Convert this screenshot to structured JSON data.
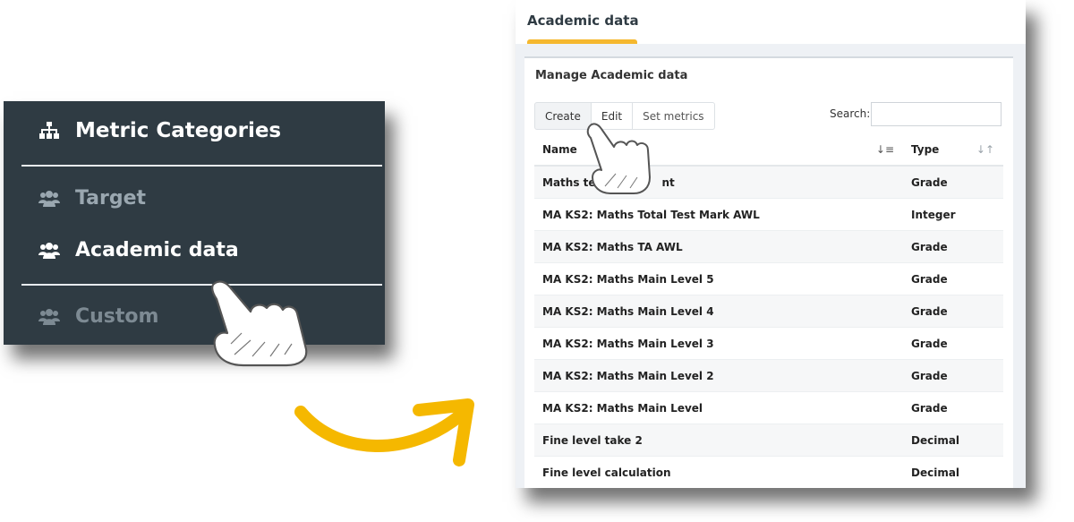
{
  "sidebar": {
    "title": "Metric Categories",
    "items": [
      {
        "label": "Target"
      },
      {
        "label": "Academic data"
      },
      {
        "label": "Custom"
      }
    ]
  },
  "panel": {
    "tab_title": "Academic data",
    "box_title": "Manage Academic data",
    "buttons": {
      "create": "Create",
      "edit": "Edit",
      "set_metrics": "Set metrics"
    },
    "search_label": "Search:",
    "search_value": "",
    "table": {
      "headers": {
        "name": "Name",
        "type": "Type"
      },
      "rows": [
        {
          "name": "Maths te",
          "name_tail": "nt",
          "type": "Grade"
        },
        {
          "name": "MA KS2: Maths Total Test Mark AWL",
          "type": "Integer"
        },
        {
          "name": "MA KS2: Maths TA AWL",
          "type": "Grade"
        },
        {
          "name": "MA KS2: Maths Main Level 5",
          "type": "Grade"
        },
        {
          "name": "MA KS2: Maths Main Level 4",
          "type": "Grade"
        },
        {
          "name": "MA KS2: Maths Main Level 3",
          "type": "Grade"
        },
        {
          "name": "MA KS2: Maths Main Level 2",
          "type": "Grade"
        },
        {
          "name": "MA KS2: Maths Main Level",
          "type": "Grade"
        },
        {
          "name": "Fine level take 2",
          "type": "Decimal"
        },
        {
          "name": "Fine level calculation",
          "type": "Decimal"
        }
      ]
    }
  },
  "colors": {
    "sidebar_bg": "#2f3b43",
    "accent_tab": "#f5b82e",
    "arrow": "#f5b800"
  },
  "icons": {
    "title_icon": "sitemap-icon",
    "item_icon": "users-icon",
    "pointer": "pointing-hand-icon",
    "arrow": "curved-arrow-icon"
  }
}
